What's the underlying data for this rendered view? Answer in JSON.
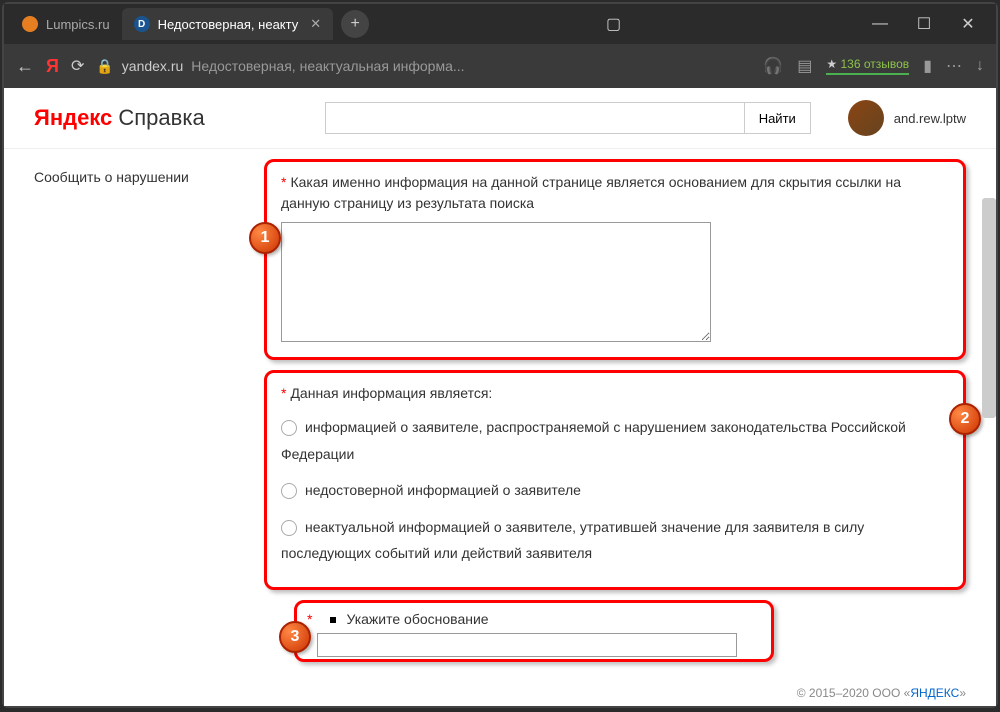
{
  "tabs": [
    {
      "title": "Lumpics.ru",
      "icon_color": "orange"
    },
    {
      "title": "Недостоверная, неакту",
      "icon_letter": "D"
    }
  ],
  "browser": {
    "back": "←",
    "ya": "Я",
    "reload": "⟳",
    "domain": "yandex.ru",
    "page_title": "Недостоверная, неактуальная информа...",
    "reviews": "136 отзывов",
    "headphones": "🎧",
    "shield": "▤",
    "bookmark": "▮",
    "dots": "⋯",
    "download": "↓",
    "tablet": "▢",
    "minimize": "—",
    "maximize": "☐",
    "close": "✕",
    "plus": "+"
  },
  "header": {
    "logo_red": "Яндекс",
    "logo_gray": " Справка",
    "search_btn": "Найти",
    "username": "and.rew.lptw"
  },
  "sidebar": {
    "link": "Сообщить о нарушении"
  },
  "form": {
    "section1_label": "Какая именно информация на данной странице является основанием для скрытия ссылки на данную страницу из результата поиска",
    "section2_label": "Данная информация является:",
    "radio1": "информацией о заявителе, распространяемой с нарушением законодательства Российской Федерации",
    "radio2": "недостоверной информацией о заявителе",
    "radio3": "неактуальной информацией о заявителе, утратившей значение для заявителя в силу последующих событий или действий заявителя",
    "section3_label": "Укажите обоснование",
    "asterisk": "*"
  },
  "badges": {
    "one": "1",
    "two": "2",
    "three": "3"
  },
  "footer": {
    "copyright": "© 2015–2020  ООО «",
    "link": "ЯНДЕКС",
    "suffix": "»"
  }
}
